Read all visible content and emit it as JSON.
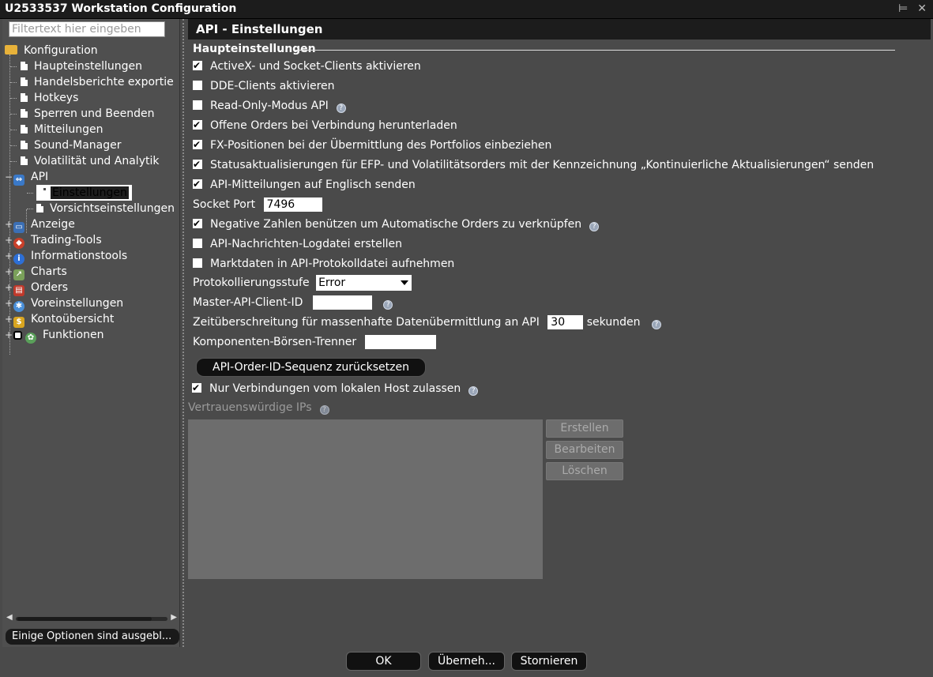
{
  "window": {
    "title": "U2533537 Workstation Configuration",
    "controls": [
      "pin-icon",
      "close-icon"
    ]
  },
  "sidebar": {
    "filter_placeholder": "Filtertext hier eingeben",
    "root": "Konfiguration",
    "items": [
      "Haupteinstellungen",
      "Handelsberichte exportie",
      "Hotkeys",
      "Sperren und Beenden",
      "Mitteilungen",
      "Sound-Manager",
      "Volatilität und Analytik",
      "API",
      "Einstellungen",
      "Vorsichtseinstellungen",
      "Anzeige",
      "Trading-Tools",
      "Informationstools",
      "Charts",
      "Orders",
      "Voreinstellungen",
      "Kontoübersicht",
      "Funktionen"
    ],
    "note": "Einige Optionen sind ausgebl..."
  },
  "panel": {
    "title": "API - Einstellungen",
    "section": "Haupteinstellungen",
    "options": [
      {
        "label": "ActiveX- und Socket-Clients aktivieren",
        "checked": true
      },
      {
        "label": "DDE-Clients aktivieren",
        "checked": false
      },
      {
        "label": "Read-Only-Modus API",
        "checked": false
      },
      {
        "label": "Offene Orders bei Verbindung herunterladen",
        "checked": true
      },
      {
        "label": "FX-Positionen bei der Übermittlung des Portfolios einbeziehen",
        "checked": true
      },
      {
        "label": "Statusaktualisierungen für EFP- und Volatilitätsorders mit der Kennzeichnung „Kontinuierliche Aktualisierungen“ senden",
        "checked": true
      },
      {
        "label": "API-Mitteilungen auf Englisch senden",
        "checked": true
      }
    ],
    "socket_port_label": "Socket Port",
    "socket_port_value": "7496",
    "options2": [
      {
        "label": "Negative Zahlen benützen um Automatische Orders zu verknüpfen",
        "checked": true
      },
      {
        "label": "API-Nachrichten-Logdatei erstellen",
        "checked": false
      },
      {
        "label": "Marktdaten in API-Protokolldatei aufnehmen",
        "checked": false
      }
    ],
    "log_level_label": "Protokollierungsstufe",
    "log_level_value": "Error",
    "master_id_label": "Master-API-Client-ID",
    "master_id_value": "",
    "timeout_label": "Zeitüberschreitung für massenhafte Datenübermittlung an API",
    "timeout_value": "30",
    "timeout_unit": "sekunden",
    "separator_label": "Komponenten-Börsen-Trenner",
    "separator_value": "",
    "reset_button": "API-Order-ID-Sequenz zurücksetzen",
    "localhost_label": "Nur Verbindungen vom lokalen Host zulassen",
    "localhost_checked": true,
    "trusted_label": "Vertrauenswürdige IPs",
    "create_button": "Erstellen",
    "edit_button": "Bearbeiten",
    "delete_button": "Löschen"
  },
  "footer": {
    "ok": "OK",
    "apply": "Überneh...",
    "cancel": "Stornieren"
  }
}
